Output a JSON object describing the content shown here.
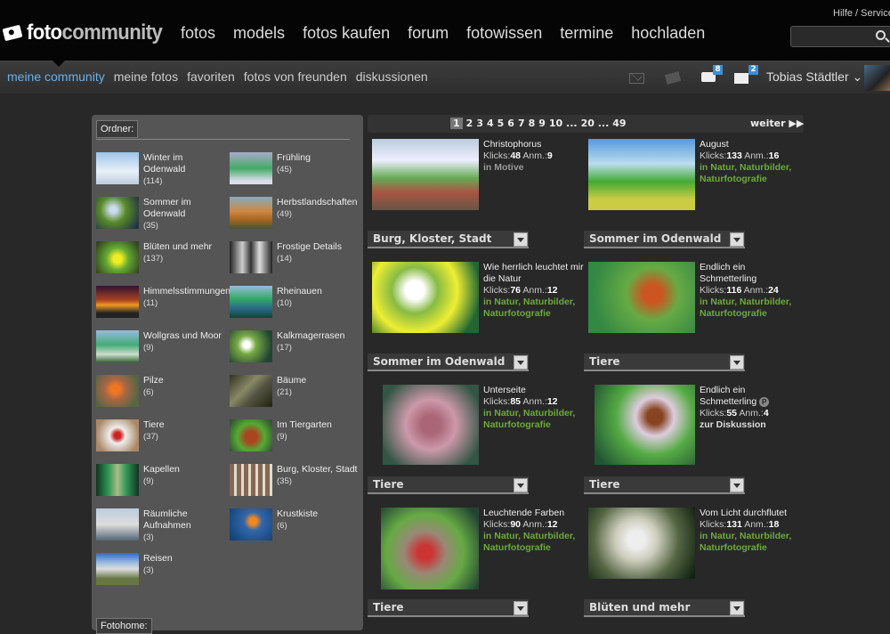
{
  "brand": {
    "prefix": "foto",
    "suffix": "community"
  },
  "main_nav": [
    "fotos",
    "models",
    "fotos kaufen",
    "forum",
    "fotowissen",
    "termine",
    "hochladen"
  ],
  "help": "Hilfe / Service",
  "sub_nav": [
    "meine community",
    "meine fotos",
    "favoriten",
    "fotos von freunden",
    "diskussionen"
  ],
  "badges": {
    "chat": "8",
    "gift": "2"
  },
  "user": "Tobias Städtler",
  "folders_label": "Ordner:",
  "fotohome_label": "Fotohome:",
  "folders": [
    {
      "name": "Winter im Odenwald",
      "count": "(114)"
    },
    {
      "name": "Frühling",
      "count": "(45)"
    },
    {
      "name": "Sommer im Odenwald",
      "count": "(35)"
    },
    {
      "name": "Herbstlandschaften",
      "count": "(49)"
    },
    {
      "name": "Blüten und mehr",
      "count": "(137)"
    },
    {
      "name": "Frostige Details",
      "count": "(14)"
    },
    {
      "name": "Himmelsstimmungen",
      "count": "(11)"
    },
    {
      "name": "Rheinauen",
      "count": "(10)"
    },
    {
      "name": "Wollgras und Moor",
      "count": "(9)"
    },
    {
      "name": "Kalkmagerrasen",
      "count": "(17)"
    },
    {
      "name": "Pilze",
      "count": "(6)"
    },
    {
      "name": "Bäume",
      "count": "(21)"
    },
    {
      "name": "Tiere",
      "count": "(37)"
    },
    {
      "name": "Im Tiergarten",
      "count": "(9)"
    },
    {
      "name": "Kapellen",
      "count": "(9)"
    },
    {
      "name": "Burg, Kloster, Stadt",
      "count": "(35)"
    },
    {
      "name": "Räumliche Aufnahmen",
      "count": "(3)"
    },
    {
      "name": "Krustkiste",
      "count": "(6)"
    },
    {
      "name": "Reisen",
      "count": "(3)"
    }
  ],
  "pager": {
    "pages": [
      "1",
      "2",
      "3",
      "4",
      "5",
      "6",
      "7",
      "8",
      "9",
      "10 ...",
      "20 ...",
      "49"
    ],
    "next": "weiter"
  },
  "photos": [
    {
      "title": "Christophorus",
      "klicks_label": "Klicks:",
      "klicks": "48",
      "anm_label": "Anm.:",
      "anm": "9",
      "category": "in Motive",
      "folder": "Burg, Kloster, Stadt"
    },
    {
      "title": "August",
      "klicks_label": "Klicks:",
      "klicks": "133",
      "anm_label": "Anm.:",
      "anm": "16",
      "category": "in Natur, Naturbilder, Naturfotografie",
      "folder": "Sommer im Odenwald"
    },
    {
      "title": "Wie herrlich leuchtet mir die Natur",
      "klicks_label": "Klicks:",
      "klicks": "76",
      "anm_label": "Anm.:",
      "anm": "12",
      "category": "in Natur, Naturbilder, Naturfotografie",
      "folder": "Sommer im Odenwald"
    },
    {
      "title": "Endlich ein Schmetterling",
      "klicks_label": "Klicks:",
      "klicks": "116",
      "anm_label": "Anm.:",
      "anm": "24",
      "category": "in Natur, Naturbilder, Naturfotografie",
      "folder": "Tiere"
    },
    {
      "title": "Unterseite",
      "klicks_label": "Klicks:",
      "klicks": "85",
      "anm_label": "Anm.:",
      "anm": "12",
      "category": "in Natur, Naturbilder, Naturfotografie",
      "folder": "Tiere"
    },
    {
      "title": "Endlich ein Schmetterling",
      "badge": "P",
      "klicks_label": "Klicks:",
      "klicks": "55",
      "anm_label": "Anm.:",
      "anm": "4",
      "category": "zur Diskussion",
      "folder": "Tiere"
    },
    {
      "title": "Leuchtende Farben",
      "klicks_label": "Klicks:",
      "klicks": "90",
      "anm_label": "Anm.:",
      "anm": "12",
      "category": "in Natur, Naturbilder, Naturfotografie",
      "folder": "Tiere"
    },
    {
      "title": "Vom Licht durchflutet",
      "klicks_label": "Klicks:",
      "klicks": "131",
      "anm_label": "Anm.:",
      "anm": "18",
      "category": "in Natur, Naturbilder, Naturfotografie",
      "folder": "Blüten und mehr"
    }
  ]
}
